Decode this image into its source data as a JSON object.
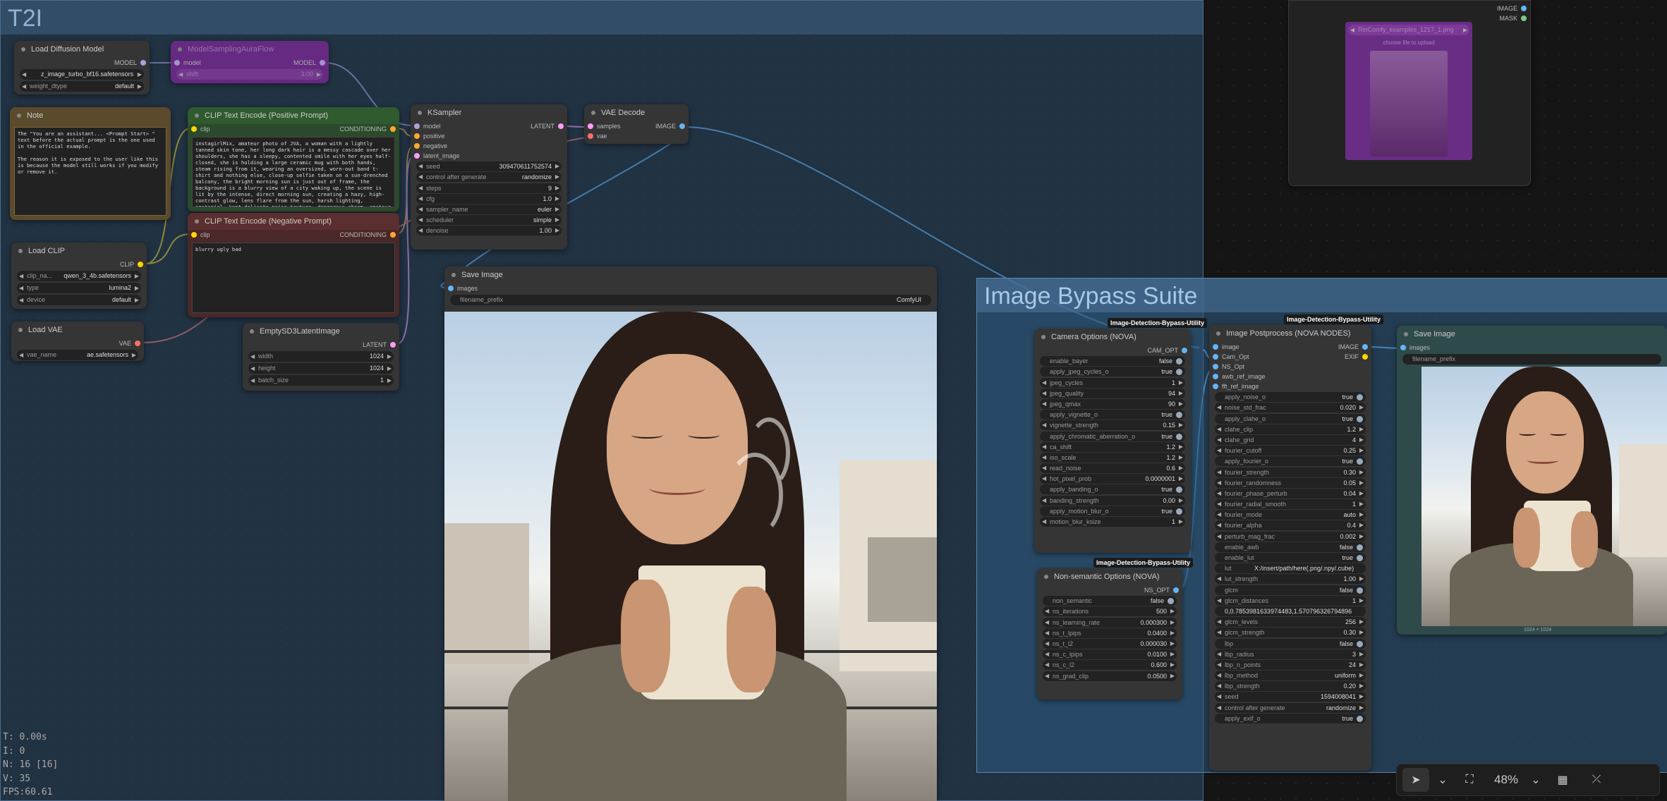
{
  "groups": {
    "t2i": "T2I",
    "bypass": "Image Bypass Suite"
  },
  "load_diffusion": {
    "title": "Load Diffusion Model",
    "out": "MODEL",
    "unet": "z_image_turbo_bf16.safetensors",
    "wd_label": "weight_dtype",
    "wd_value": "default"
  },
  "model_sampling": {
    "title": "ModelSamplingAuraFlow",
    "in": "model",
    "out": "MODEL",
    "shift_label": "shift",
    "shift": "3.00"
  },
  "note": {
    "title": "Note",
    "text": "The \"You are an assistant... <Prompt Start> \" text before the actual prompt is the one used in the official example.\n\nThe reason it is exposed to the user like this is because the model still works if you modify or remove it."
  },
  "clip_pos": {
    "title": "CLIP Text Encode (Positive Prompt)",
    "in": "clip",
    "out": "CONDITIONING",
    "text": "instagirlMix, amateur photo of JVA, a woman with a lightly tanned skin tone, her long dark hair is a messy cascade over her shoulders, she has a sleepy, contented smile with her eyes half-closed, she is holding a large ceramic mug with both hands, steam rising from it, wearing an oversized, worn-out band t-shirt and nothing else, close-up selfie taken on a sun-drenched balcony, the bright morning sun is just out of frame, the background is a blurry view of a city waking up, the scene is lit by the intense, direct morning sun, creating a hazy, high-contrast glow, lens flare from the sun, harsh lighting, instagirl, kept delicate noise texture, dangerous charm, amateur cellphone quality, visible sensor noise, heavy HDR glow, amateur"
  },
  "clip_neg": {
    "title": "CLIP Text Encode (Negative Prompt)",
    "in": "clip",
    "out": "CONDITIONING",
    "text": "blurry ugly bad"
  },
  "load_clip": {
    "title": "Load CLIP",
    "out": "CLIP",
    "name_label": "clip_na...",
    "name": "qwen_3_4b.safetensors",
    "type_label": "type",
    "type": "lumina2",
    "device_label": "device",
    "device": "default"
  },
  "load_vae": {
    "title": "Load VAE",
    "out": "VAE",
    "name_label": "vae_name",
    "name": "ae.safetensors"
  },
  "empty_latent": {
    "title": "EmptySD3LatentImage",
    "out": "LATENT",
    "w_label": "width",
    "w": "1024",
    "h_label": "height",
    "h": "1024",
    "b_label": "batch_size",
    "b": "1"
  },
  "ksampler": {
    "title": "KSampler",
    "inputs": [
      "model",
      "positive",
      "negative",
      "latent_image"
    ],
    "out": "LATENT",
    "widgets": [
      [
        "seed",
        "309470611752574"
      ],
      [
        "control after generate",
        "randomize"
      ],
      [
        "steps",
        "9"
      ],
      [
        "cfg",
        "1.0"
      ],
      [
        "sampler_name",
        "euler"
      ],
      [
        "scheduler",
        "simple"
      ],
      [
        "denoise",
        "1.00"
      ]
    ]
  },
  "vae_decode": {
    "title": "VAE Decode",
    "inputs": [
      "samples",
      "vae"
    ],
    "out": "IMAGE"
  },
  "save1": {
    "title": "Save Image",
    "in": "images",
    "fp_label": "filename_prefix",
    "fp": "ComfyUI"
  },
  "topright": {
    "out1": "IMAGE",
    "out2": "MASK",
    "file": "ReiComfy_examples_1217_1.png",
    "upload": "choose file to upload"
  },
  "camera": {
    "badge": "Image-Detection-Bypass-Utility",
    "title": "Camera Options (NOVA)",
    "out": "CAM_OPT",
    "widgets": [
      [
        "enable_bayer",
        "false",
        "t"
      ],
      [
        "apply_jpeg_cycles_o",
        "true",
        "t"
      ],
      [
        "jpeg_cycles",
        "1",
        "n"
      ],
      [
        "jpeg_quality",
        "94",
        "n"
      ],
      [
        "jpeg_qmax",
        "90",
        "n"
      ],
      [
        "apply_vignette_o",
        "true",
        "t"
      ],
      [
        "vignette_strength",
        "0.15",
        "n"
      ],
      [
        "apply_chromatic_aberration_o",
        "true",
        "t"
      ],
      [
        "ca_shift",
        "1.2",
        "n"
      ],
      [
        "iso_scale",
        "1.2",
        "n"
      ],
      [
        "read_noise",
        "0.6",
        "n"
      ],
      [
        "hot_pixel_prob",
        "0.0000001",
        "n"
      ],
      [
        "apply_banding_o",
        "true",
        "t"
      ],
      [
        "banding_strength",
        "0.00",
        "n"
      ],
      [
        "apply_motion_blur_o",
        "true",
        "t"
      ],
      [
        "motion_blur_ksize",
        "1",
        "n"
      ]
    ]
  },
  "nonsem": {
    "badge": "Image-Detection-Bypass-Utility",
    "title": "Non-semantic Options (NOVA)",
    "out": "NS_OPT",
    "widgets": [
      [
        "non_semantic",
        "false",
        "t"
      ],
      [
        "ns_iterations",
        "500",
        "n"
      ],
      [
        "ns_learning_rate",
        "0.000300",
        "n"
      ],
      [
        "ns_t_lpips",
        "0.0400",
        "n"
      ],
      [
        "ns_t_l2",
        "0.000030",
        "n"
      ],
      [
        "ns_c_lpips",
        "0.0100",
        "n"
      ],
      [
        "ns_c_l2",
        "0.600",
        "n"
      ],
      [
        "ns_grad_clip",
        "0.0500",
        "n"
      ]
    ]
  },
  "post": {
    "badge": "Image-Detection-Bypass-Utility",
    "title": "Image Postprocess (NOVA NODES)",
    "inputs": [
      "image",
      "Cam_Opt",
      "NS_Opt",
      "awb_ref_image",
      "fft_ref_image"
    ],
    "out1": "IMAGE",
    "out2": "EXIF",
    "widgets": [
      [
        "apply_noise_o",
        "true",
        "t"
      ],
      [
        "noise_std_frac",
        "0.020",
        "n"
      ],
      [
        "apply_clahe_o",
        "true",
        "t"
      ],
      [
        "clahe_clip",
        "1.2",
        "n"
      ],
      [
        "clahe_grid",
        "4",
        "n"
      ],
      [
        "fourier_cutoff",
        "0.25",
        "n"
      ],
      [
        "apply_fourier_o",
        "true",
        "t"
      ],
      [
        "fourier_strength",
        "0.30",
        "n"
      ],
      [
        "fourier_randomness",
        "0.05",
        "n"
      ],
      [
        "fourier_phase_perturb",
        "0.04",
        "n"
      ],
      [
        "fourier_radial_smooth",
        "1",
        "n"
      ],
      [
        "fourier_mode",
        "auto",
        "n"
      ],
      [
        "fourier_alpha",
        "0.4",
        "n"
      ],
      [
        "perturb_mag_frac",
        "0.002",
        "n"
      ],
      [
        "enable_awb",
        "false",
        "t"
      ],
      [
        "enable_lut",
        "true",
        "t"
      ],
      [
        "lut",
        "X:/insert/path/here(.png/.npy/.cube)",
        "p"
      ],
      [
        "lut_strength",
        "1.00",
        "n"
      ],
      [
        "glcm",
        "false",
        "t"
      ],
      [
        "glcm_distances",
        "1",
        "n"
      ],
      [
        "",
        "0,0.7853981633974483,1.5707963267948966,",
        "p"
      ],
      [
        "glcm_levels",
        "256",
        "n"
      ],
      [
        "glcm_strength",
        "0.30",
        "n"
      ],
      [
        "lbp",
        "false",
        "t"
      ],
      [
        "lbp_radius",
        "3",
        "n"
      ],
      [
        "lbp_n_points",
        "24",
        "n"
      ],
      [
        "lbp_method",
        "uniform",
        "n"
      ],
      [
        "lbp_strength",
        "0.20",
        "n"
      ],
      [
        "seed",
        "1594008041",
        "n"
      ],
      [
        "control after generate",
        "randomize",
        "n"
      ],
      [
        "apply_exif_o",
        "true",
        "t"
      ]
    ]
  },
  "save2": {
    "title": "Save Image",
    "in": "images",
    "fp_label": "filename_prefix",
    "size": "1024 × 1024"
  },
  "stats": {
    "t": "T: 0.00s",
    "i": "I: 0",
    "n": "N: 16 [16]",
    "v": "V: 35",
    "fps": "FPS:60.61"
  },
  "toolbar": {
    "zoom": "48%"
  },
  "colors": {
    "clip": "#ffd500",
    "model": "#b39ddb",
    "cond": "#ffa931",
    "latent": "#ff9cf9",
    "vae": "#ff6e6e",
    "image": "#64b5f6"
  }
}
